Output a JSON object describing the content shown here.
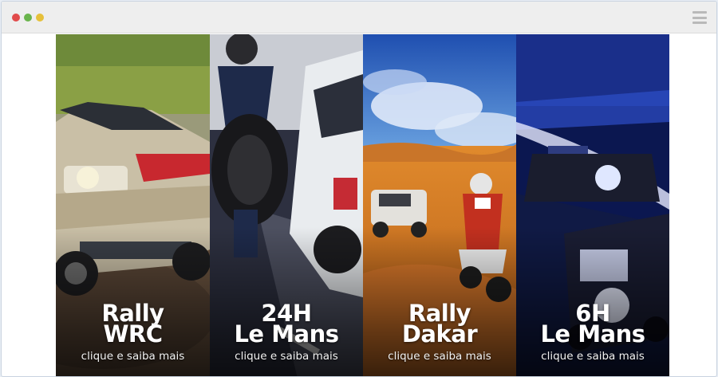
{
  "window": {
    "menu_icon": "hamburger-menu-icon"
  },
  "panels": [
    {
      "title_line1": "Rally",
      "title_line2": "WRC",
      "cta": "clique e saiba mais",
      "image": "rally-car-dirt-road"
    },
    {
      "title_line1": "24H",
      "title_line2": "Le Mans",
      "cta": "clique e saiba mais",
      "image": "pit-stop-tire-change"
    },
    {
      "title_line1": "Rally",
      "title_line2": "Dakar",
      "cta": "clique e saiba mais",
      "image": "desert-motorbike-and-truck"
    },
    {
      "title_line1": "6H",
      "title_line2": "Le Mans",
      "cta": "clique e saiba mais",
      "image": "prototype-race-cars-night"
    }
  ]
}
